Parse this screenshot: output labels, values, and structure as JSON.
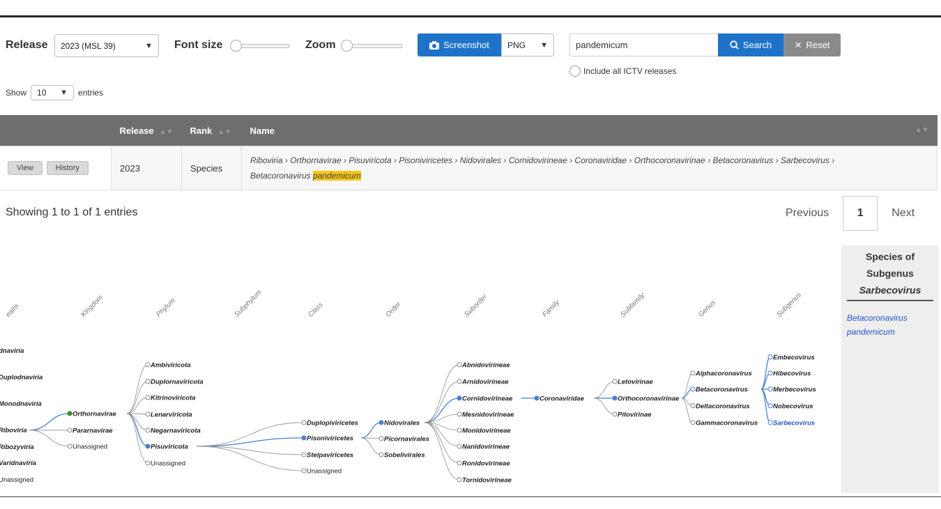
{
  "toolbar": {
    "release_label": "Release",
    "release_value": "2023 (MSL 39)",
    "font_size_label": "Font size",
    "zoom_label": "Zoom",
    "screenshot_label": "Screenshot",
    "format_value": "PNG",
    "search_value": "pandemicum",
    "search_label": "Search",
    "reset_label": "Reset",
    "include_all_label": "Include all ICTV releases",
    "show_label": "Show",
    "entries_value": "10",
    "entries_label": "entries"
  },
  "table": {
    "headers": [
      "",
      "Release",
      "Rank",
      "Name"
    ],
    "row": {
      "view_label": "View",
      "history_label": "History",
      "release": "2023",
      "rank": "Species",
      "lineage_prefix": "Riboviria › Orthornavirae › Pisuviricota › Pisoniviricetes › Nidovirales › Cornidovirineae › Coronaviridae › Orthocoronavirinae › Betacoronavirus › Sarbecovirus ›",
      "lineage_species_genus": "Betacoronavirus",
      "lineage_species_epithet": "pandemicum"
    }
  },
  "pagination": {
    "info": "Showing 1 to 1 of 1 entries",
    "previous": "Previous",
    "page": "1",
    "next": "Next"
  },
  "side_panel": {
    "title_line1": "Species of",
    "title_line2": "Subgenus",
    "title_line3": "Sarbecovirus",
    "item_line1": "Betacoronavirus",
    "item_line2": "pandemicum"
  },
  "tree": {
    "rank_headers": [
      "ealm",
      "Kingdom",
      "Phylum",
      "Subphylum",
      "Class",
      "Order",
      "Suborder",
      "Family",
      "Subfamily",
      "Genus",
      "Subgenus"
    ],
    "realms": [
      "dnaviria",
      "Duplodnaviria",
      "Monodnaviria",
      "Riboviria",
      "Ribozyviria",
      "Varidnaviria",
      "Unassigned"
    ],
    "kingdoms": [
      "Orthornavirae",
      "Pararnavirae",
      "Unassigned"
    ],
    "phyla": [
      "Ambiviricota",
      "Duplornaviricota",
      "Kitrinoviricota",
      "Lenarviricota",
      "Negarnaviricota",
      "Pisuviricota",
      "Unassigned"
    ],
    "classes": [
      "Duplopiviricetes",
      "Pisoniviricetes",
      "Stelpaviricetes",
      "Unassigned"
    ],
    "orders": [
      "Nidovirales",
      "Picornavirales",
      "Sobelivirales"
    ],
    "suborders": [
      "Abnidovirineae",
      "Arnidovirineae",
      "Cornidovirineae",
      "Mesnidovirineae",
      "Monidovirineae",
      "Nanidovirineae",
      "Ronidovirineae",
      "Tornidovirineae"
    ],
    "families": [
      "Coronaviridae"
    ],
    "subfamilies": [
      "Letovirinae",
      "Orthocoronavirinae",
      "Pitovirinae"
    ],
    "genera": [
      "Alphacoronavirus",
      "Betacoronavirus",
      "Deltacoronavirus",
      "Gammacoronavirus"
    ],
    "subgenera": [
      "Embecovirus",
      "Hibecovirus",
      "Merbecovirus",
      "Nobecovirus",
      "Sarbecovirus"
    ]
  },
  "colors": {
    "primary_blue": "#1e73c9",
    "reset_grey": "#8a8a8a",
    "header_grey": "#6e6e6e",
    "highlight": "#f5c518",
    "path_blue": "#4a7fd0",
    "kingdom_green": "#3a8a2a"
  }
}
